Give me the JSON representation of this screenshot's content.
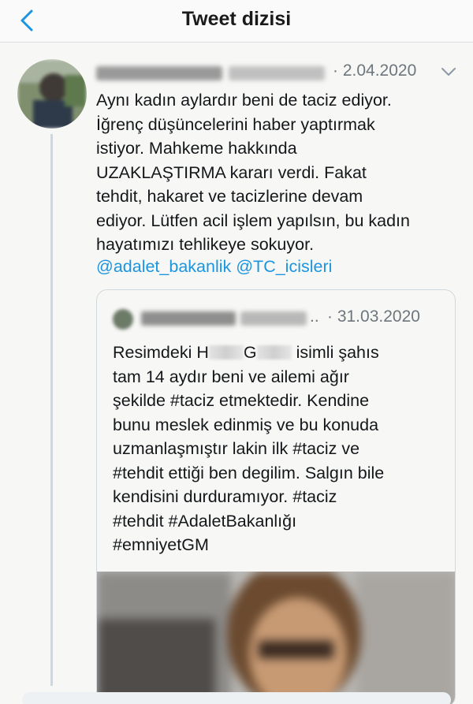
{
  "header": {
    "title": "Tweet dizisi",
    "back_icon": "chevron-left-icon",
    "accent_color": "#1b95e0"
  },
  "tweet": {
    "date": "· 2.04.2020",
    "more_icon": "chevron-down-icon",
    "lines": [
      "Aynı kadın aylardır beni de taciz ediyor.",
      "İğrenç düşüncelerini haber yaptırmak",
      "istiyor. Mahkeme hakkında",
      "UZAKLAŞTIRMA kararı verdi. Fakat",
      "tehdit, hakaret ve tacizlerine devam",
      "ediyor. Lütfen acil işlem yapılsın, bu kadın",
      "hayatımızı tehlikeye sokuyor."
    ],
    "mentions": [
      "@adalet_bakanlik",
      "@TC_icisleri"
    ]
  },
  "quoted_tweet": {
    "ellipsis": "..",
    "date": "· 31.03.2020",
    "line1_a": "Resimdeki H",
    "line1_b": "G",
    "line1_c": " isimli şahıs",
    "lines": [
      "tam 14 aydır beni ve ailemi ağır",
      "şekilde #taciz etmektedir. Kendine",
      "bunu meslek edinmiş ve bu konuda",
      "uzmanlaşmıştır lakin ilk #taciz ve",
      "#tehdit ettiği ben degilim. Salgın bile",
      "kendisini durduramıyor. #taciz",
      "#tehdit #AdaletBakanlığı",
      "#emniyetGM"
    ]
  }
}
